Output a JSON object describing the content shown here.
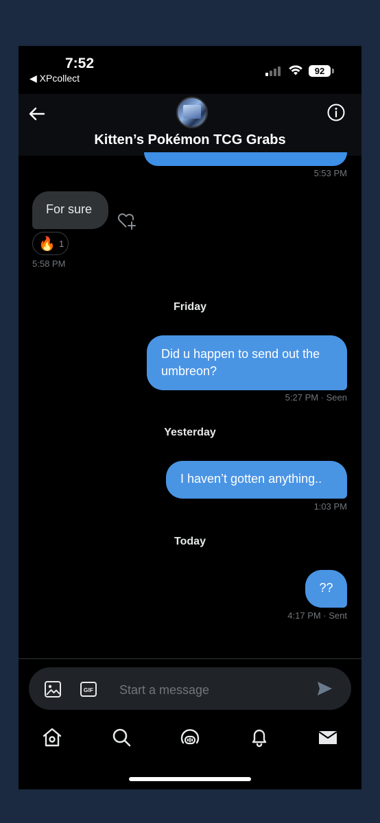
{
  "status_bar": {
    "time": "7:52",
    "back_app": "◀ XPcollect",
    "battery": "92"
  },
  "header": {
    "title": "Kitten’s Pokémon TCG Grabs",
    "back_icon": "arrow-left-icon",
    "info_icon": "info-circle-icon"
  },
  "messages": [
    {
      "id": "m0",
      "direction": "sent",
      "text": "",
      "meta": "5:53 PM"
    },
    {
      "id": "m1",
      "direction": "received",
      "text": "For sure",
      "meta": "5:58 PM",
      "reaction": {
        "emoji": "🔥",
        "count": "1"
      }
    },
    {
      "id": "m2",
      "direction": "sent",
      "day_label": "Friday",
      "lines": [
        "Did u happen to send out the",
        "umbreon?"
      ],
      "meta": "5:27 PM · Seen"
    },
    {
      "id": "m3",
      "direction": "sent",
      "day_label": "Yesterday",
      "text": "I haven’t gotten anything..",
      "meta": "1:03 PM"
    },
    {
      "id": "m4",
      "direction": "sent",
      "day_label": "Today",
      "text": "??",
      "meta": "4:17 PM · Sent"
    }
  ],
  "composer": {
    "placeholder": "Start a message",
    "gif_label": "GIF"
  },
  "bottom_nav": [
    {
      "icon": "home-icon"
    },
    {
      "icon": "search-icon"
    },
    {
      "icon": "spaces-icon"
    },
    {
      "icon": "bell-icon"
    },
    {
      "icon": "mail-icon",
      "active": true
    }
  ],
  "colors": {
    "sent_bubble": "#4a94e4",
    "received_bubble": "#2f3336",
    "background": "#000000",
    "frame_background": "#1b2a40",
    "muted_text": "#71767b"
  }
}
